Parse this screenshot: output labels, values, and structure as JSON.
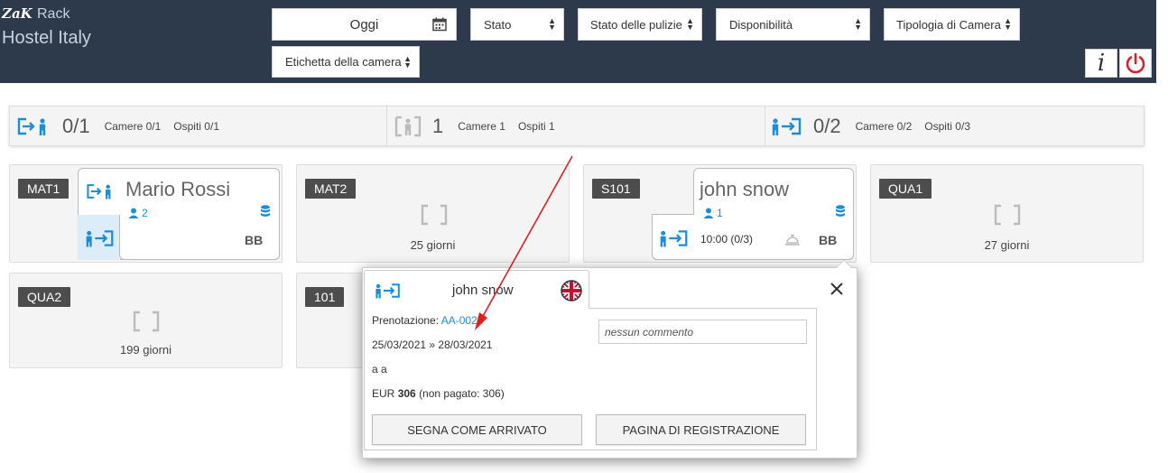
{
  "brand": {
    "logo": "ZaK",
    "app": "Rack",
    "property": "Hostel Italy"
  },
  "filters": {
    "date": "Oggi",
    "stato": "Stato",
    "stato_pulizie": "Stato delle pulizie",
    "disponibilita": "Disponibilità",
    "tipologia": "Tipologia di Camera",
    "etichetta": "Etichetta della camera"
  },
  "summary": {
    "checkin": {
      "big": "0/1",
      "camere": "Camere 0/1",
      "ospiti": "Ospiti 0/1"
    },
    "present": {
      "big": "1",
      "camere": "Camere 1",
      "ospiti": "Ospiti 1"
    },
    "checkout": {
      "big": "0/2",
      "camere": "Camere 0/2",
      "ospiti": "Ospiti 0/3"
    }
  },
  "rooms": {
    "mat1": {
      "label": "MAT1",
      "guest": "Mario Rossi",
      "guests": "2",
      "board": "BB"
    },
    "mat2": {
      "label": "MAT2",
      "days": "25 giorni"
    },
    "s101": {
      "label": "S101",
      "guest": "john snow",
      "guests": "1",
      "time": "10:00 (0/3)",
      "board": "BB"
    },
    "qua1": {
      "label": "QUA1",
      "days": "27 giorni"
    },
    "qua2": {
      "label": "QUA2",
      "days": "199 giorni"
    },
    "r101": {
      "label": "101"
    }
  },
  "popup": {
    "guest": "john snow",
    "booking_label": "Prenotazione:",
    "booking_code": "AA-0023",
    "dates": "25/03/2021 » 28/03/2021",
    "names": "a a",
    "price_prefix": "EUR",
    "price_amount": "306",
    "price_suffix": "(non pagato: 306)",
    "comment_placeholder": "nessun commento",
    "btn_arrived": "SEGNA COME ARRIVATO",
    "btn_registration": "PAGINA DI REGISTRAZIONE"
  },
  "colors": {
    "topbar": "#2c3a4b",
    "accent": "#1a8fd8",
    "power": "#d9232b",
    "annotation": "#e02020"
  }
}
